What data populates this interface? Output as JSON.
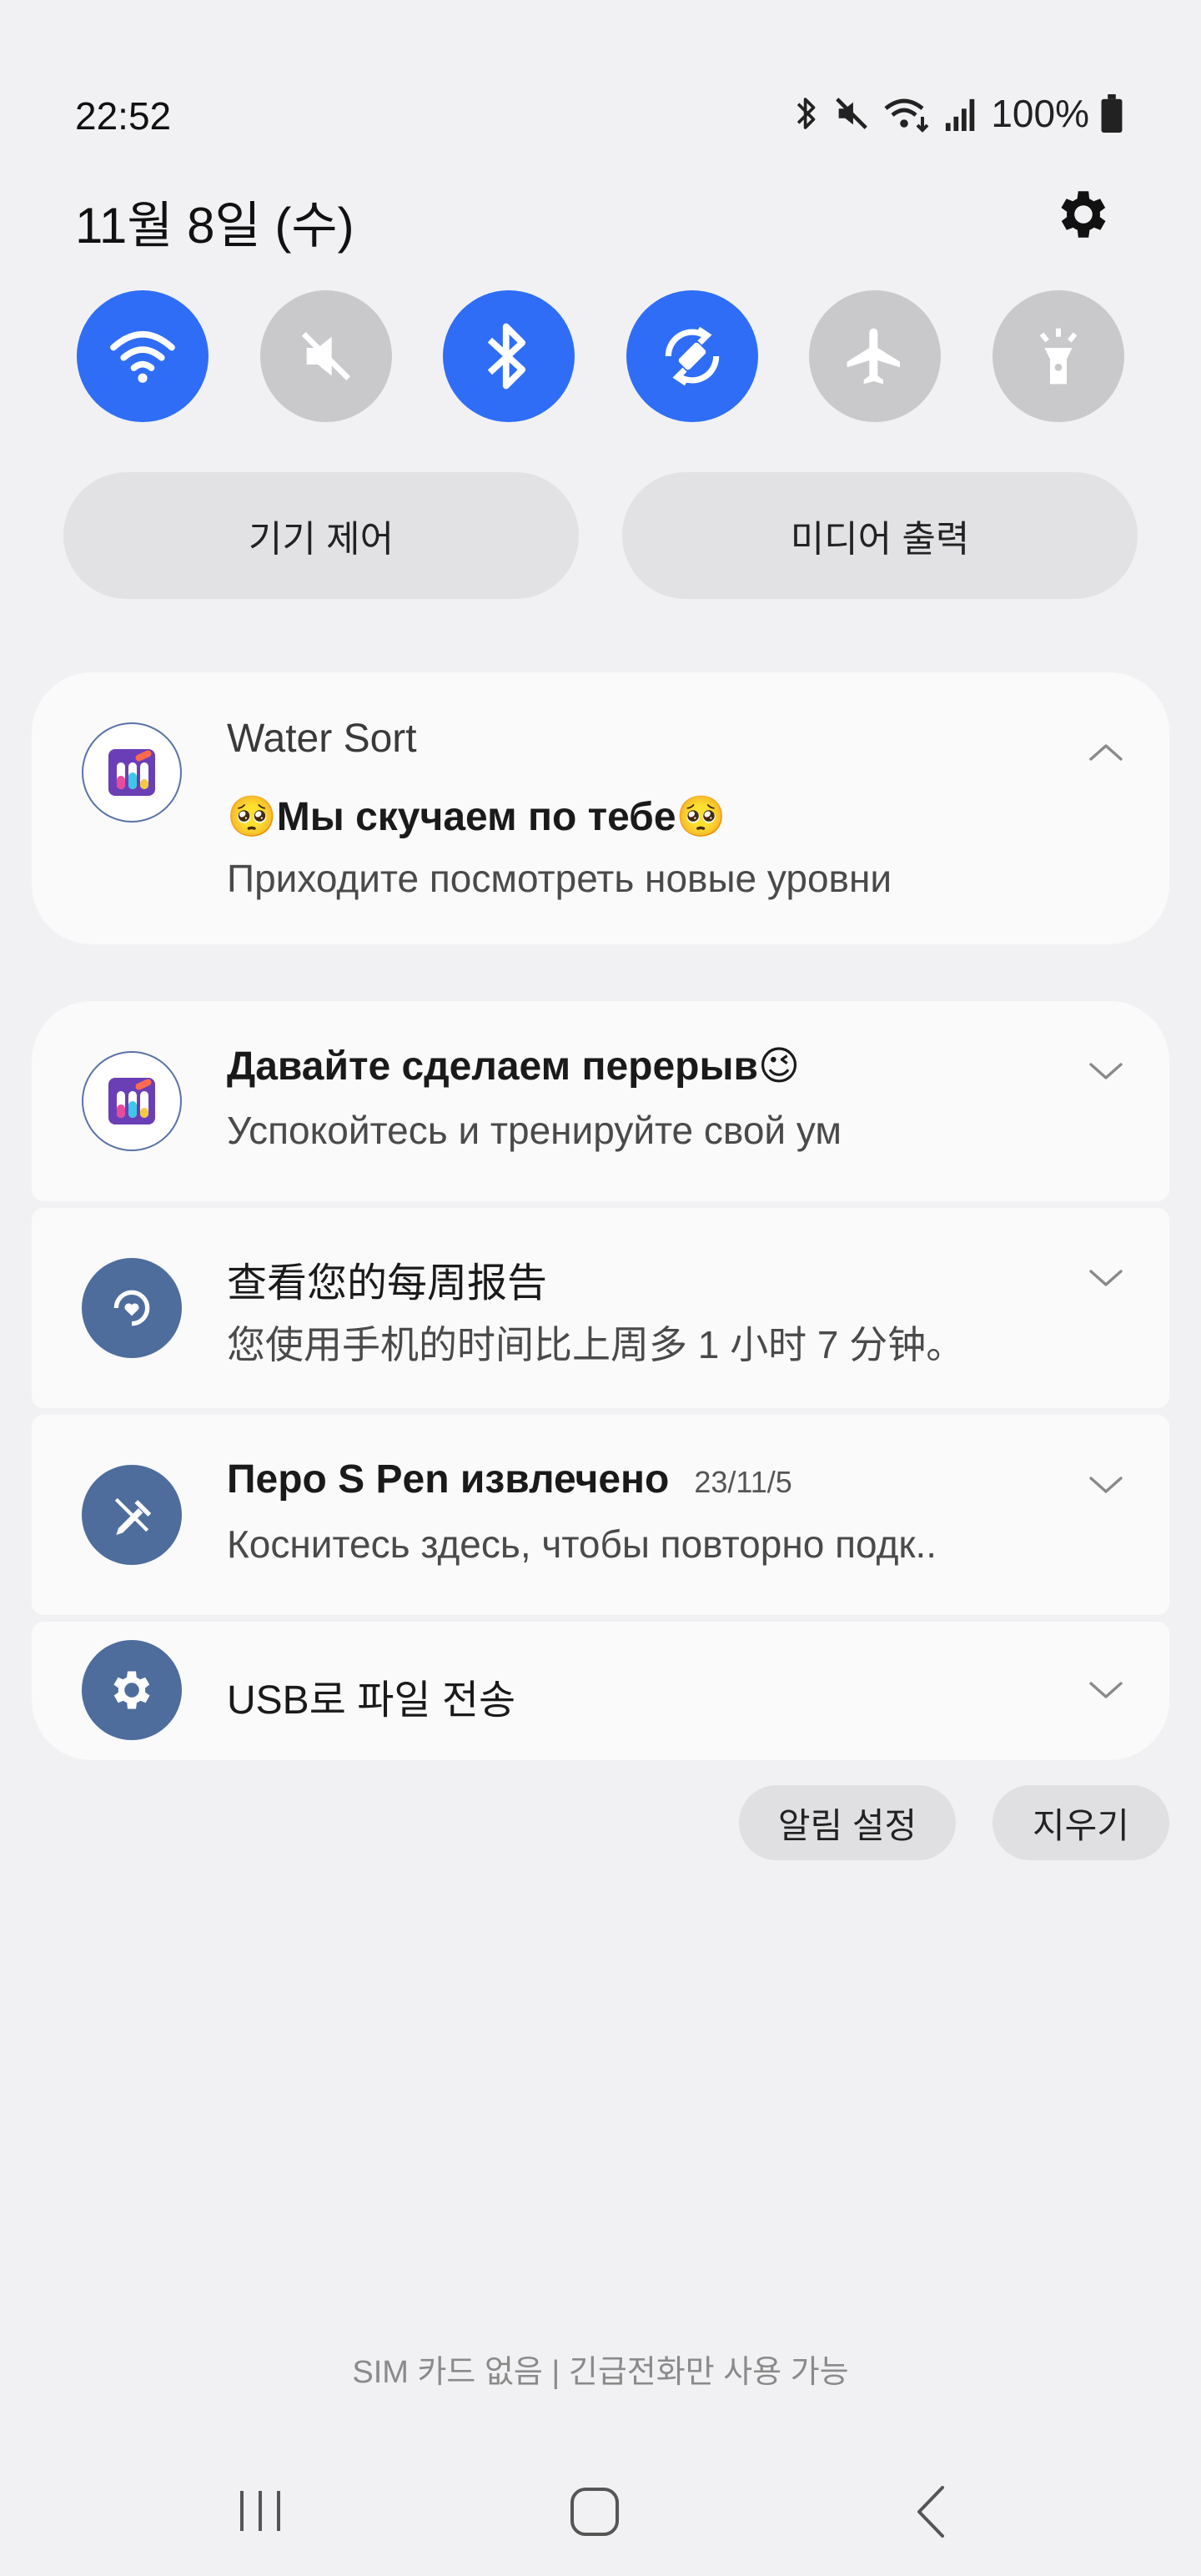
{
  "status_bar": {
    "time": "22:52",
    "battery": "100%",
    "icons": [
      "bluetooth-icon",
      "mute-icon",
      "wifi-sync-icon",
      "signal-icon",
      "battery-icon"
    ]
  },
  "header": {
    "date": "11월 8일 (수)"
  },
  "quick_settings": [
    {
      "name": "wifi",
      "icon": "wifi-icon",
      "state": "on"
    },
    {
      "name": "sound",
      "icon": "mute-icon",
      "state": "off"
    },
    {
      "name": "bluetooth",
      "icon": "bluetooth-icon",
      "state": "on"
    },
    {
      "name": "auto-rotate",
      "icon": "rotate-icon",
      "state": "on"
    },
    {
      "name": "airplane",
      "icon": "airplane-icon",
      "state": "off"
    },
    {
      "name": "flashlight",
      "icon": "flashlight-icon",
      "state": "off"
    }
  ],
  "pills": {
    "device_control": "기기 제어",
    "media_output": "미디어 출력"
  },
  "notifications": [
    {
      "app": "Water Sort",
      "title": "🥺Мы скучаем по тебе🥺",
      "body": "Приходите посмотреть новые уровни"
    },
    {
      "title": "Давайте сделаем перерыв😉",
      "body": "Успокойтесь и тренируйте свой ум"
    },
    {
      "title": "查看您的每周报告",
      "body": "您使用手机的时间比上周多 1 小时 7 分钟。"
    },
    {
      "title": "Перо S Pen извлечено",
      "time": "23/11/5",
      "body": "Коснитесь здесь, чтобы повторно подк.."
    },
    {
      "title": "USB로 파일 전송"
    }
  ],
  "actions": {
    "notification_settings": "알림 설정",
    "clear": "지우기"
  },
  "footer": {
    "sim_status": "SIM 카드 없음 | 긴급전화만 사용 가능"
  },
  "colors": {
    "accent": "#2f6df6",
    "tile_off": "#c9c9cc",
    "card": "#fafafb",
    "app_icon": "#4e6d9c"
  }
}
